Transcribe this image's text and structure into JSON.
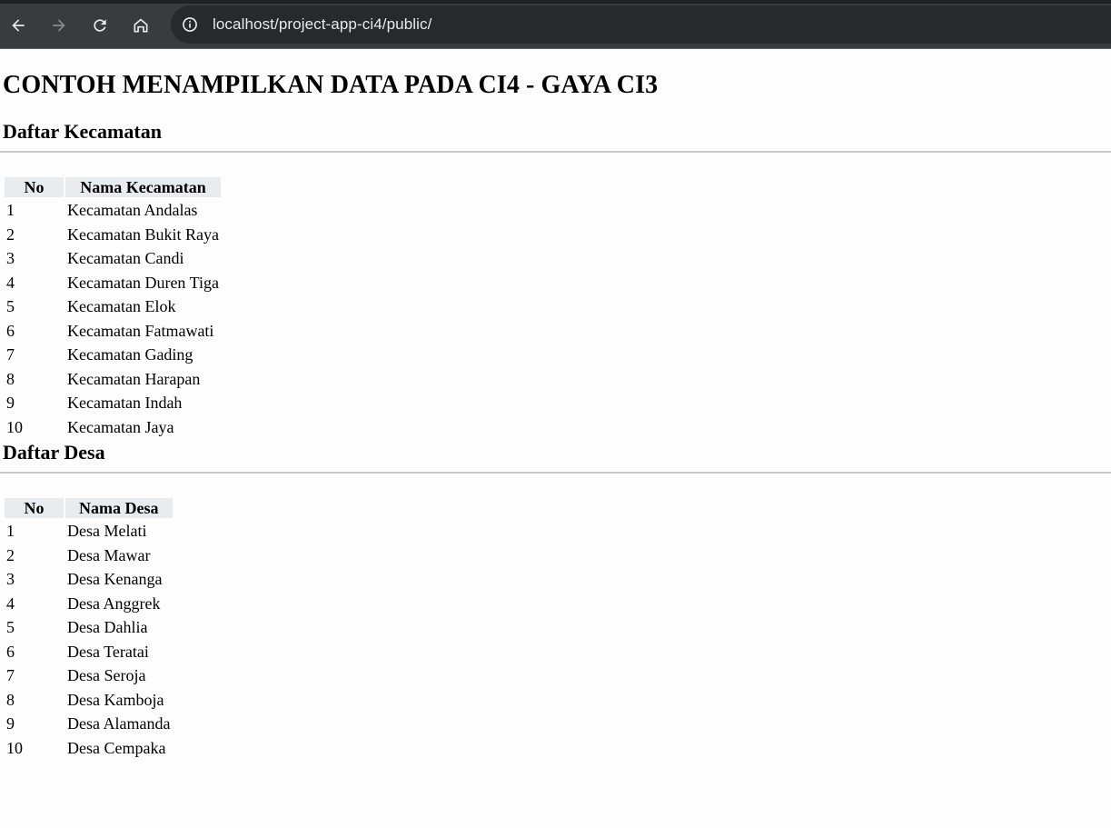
{
  "browser": {
    "url": "localhost/project-app-ci4/public/",
    "icons": [
      "back-arrow-icon",
      "forward-arrow-icon",
      "reload-icon",
      "home-icon",
      "info-icon"
    ]
  },
  "page": {
    "title": "CONTOH MENAMPILKAN DATA PADA CI4 - GAYA CI3"
  },
  "kecamatan": {
    "heading": "Daftar Kecamatan",
    "col_no": "No",
    "col_name": "Nama Kecamatan",
    "rows": [
      {
        "no": "1",
        "name": "Kecamatan Andalas"
      },
      {
        "no": "2",
        "name": "Kecamatan Bukit Raya"
      },
      {
        "no": "3",
        "name": "Kecamatan Candi"
      },
      {
        "no": "4",
        "name": "Kecamatan Duren Tiga"
      },
      {
        "no": "5",
        "name": "Kecamatan Elok"
      },
      {
        "no": "6",
        "name": "Kecamatan Fatmawati"
      },
      {
        "no": "7",
        "name": "Kecamatan Gading"
      },
      {
        "no": "8",
        "name": "Kecamatan Harapan"
      },
      {
        "no": "9",
        "name": "Kecamatan Indah"
      },
      {
        "no": "10",
        "name": "Kecamatan Jaya"
      }
    ]
  },
  "desa": {
    "heading": "Daftar Desa",
    "col_no": "No",
    "col_name": "Nama Desa",
    "rows": [
      {
        "no": "1",
        "name": "Desa Melati"
      },
      {
        "no": "2",
        "name": "Desa Mawar"
      },
      {
        "no": "3",
        "name": "Desa Kenanga"
      },
      {
        "no": "4",
        "name": "Desa Anggrek"
      },
      {
        "no": "5",
        "name": "Desa Dahlia"
      },
      {
        "no": "6",
        "name": "Desa Teratai"
      },
      {
        "no": "7",
        "name": "Desa Seroja"
      },
      {
        "no": "8",
        "name": "Desa Kamboja"
      },
      {
        "no": "9",
        "name": "Desa Alamanda"
      },
      {
        "no": "10",
        "name": "Desa Cempaka"
      }
    ]
  }
}
